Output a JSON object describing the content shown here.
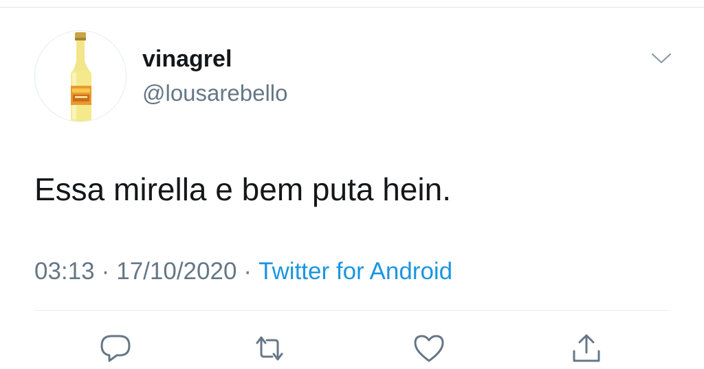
{
  "tweet": {
    "display_name": "vinagrel",
    "username": "@lousarebello",
    "text": "Essa mirella e bem puta hein.",
    "time": "03:13",
    "separator": "·",
    "date": "17/10/2020",
    "source": "Twitter for Android"
  },
  "actions": {
    "reply_icon": "reply-icon",
    "retweet_icon": "retweet-icon",
    "like_icon": "heart-icon",
    "share_icon": "share-icon"
  },
  "colors": {
    "text": "#14171a",
    "secondary": "#657786",
    "link": "#1b95e0",
    "icon": "#657786",
    "divider": "#e6ecf0"
  }
}
